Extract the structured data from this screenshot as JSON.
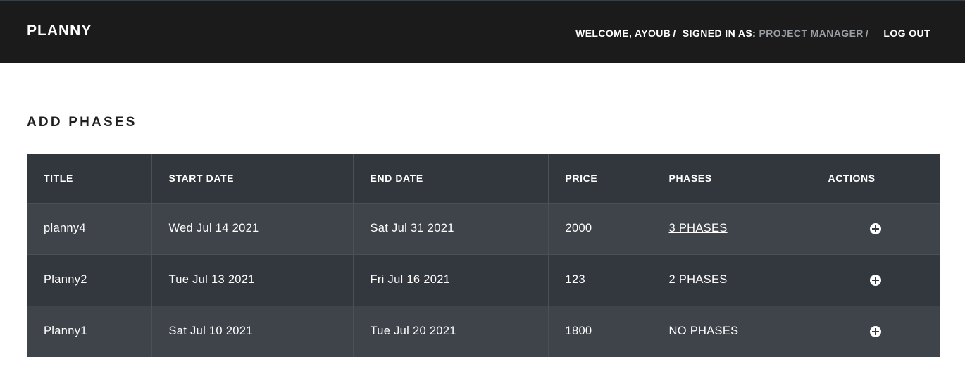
{
  "header": {
    "brand": "PLANNY",
    "welcome": "WELCOME, AYOUB",
    "signed_in_label": "SIGNED IN AS:",
    "role": "PROJECT MANAGER",
    "separator": "/",
    "logout": "LOG OUT"
  },
  "page": {
    "title": "ADD PHASES"
  },
  "table": {
    "columns": [
      "TITLE",
      "START DATE",
      "END DATE",
      "PRICE",
      "PHASES",
      "ACTIONS"
    ],
    "rows": [
      {
        "title": "planny4",
        "start": "Wed Jul 14 2021",
        "end": "Sat Jul 31 2021",
        "price": "2000",
        "phases": "3 PHASES"
      },
      {
        "title": "Planny2",
        "start": "Tue Jul 13 2021",
        "end": "Fri Jul 16 2021",
        "price": "123",
        "phases": "2 PHASES"
      },
      {
        "title": "Planny1",
        "start": "Sat Jul 10 2021",
        "end": "Tue Jul 20 2021",
        "price": "1800",
        "phases": "NO PHASES"
      }
    ]
  },
  "icons": {
    "add_action": "plus-circle-icon"
  }
}
